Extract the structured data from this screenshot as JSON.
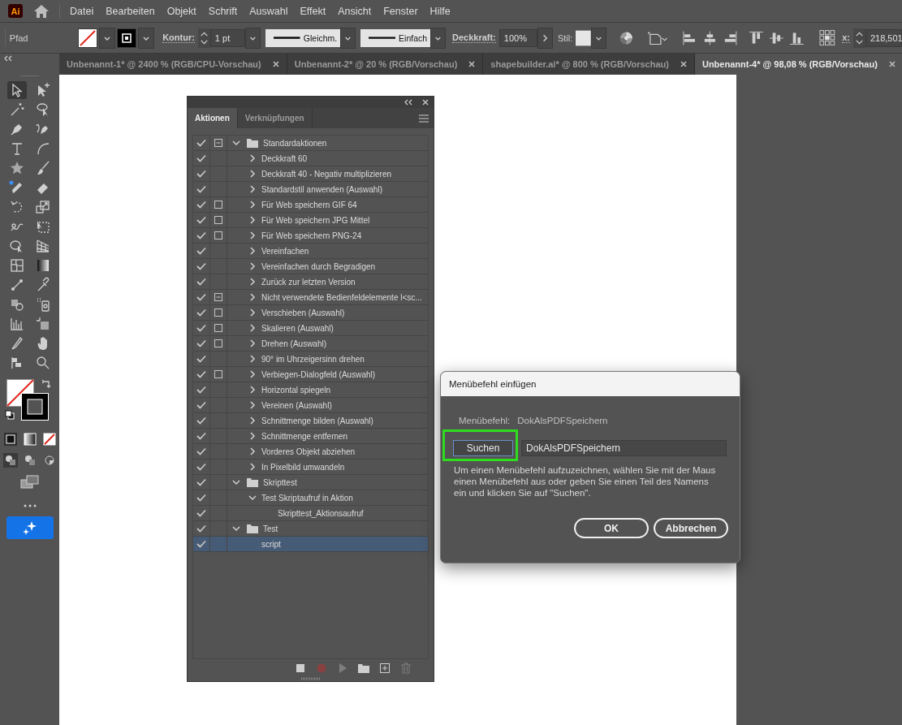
{
  "menu_bar": {
    "logo": "Ai",
    "items": [
      "Datei",
      "Bearbeiten",
      "Objekt",
      "Schrift",
      "Auswahl",
      "Effekt",
      "Ansicht",
      "Fenster",
      "Hilfe"
    ]
  },
  "control_bar": {
    "selection_label": "Pfad",
    "fill_none": true,
    "stroke_label": "Kontur:",
    "stroke_weight": "1 pt",
    "stroke_profile": "Gleichm.",
    "brush": "Einfach",
    "opacity_label": "Deckkraft:",
    "opacity": "100%",
    "style_label": "Stil:",
    "x_label": "x:",
    "x_value": "218,501"
  },
  "document_tabs": [
    {
      "label": "Unbenannt-1* @ 2400 % (RGB/CPU-Vorschau)",
      "selected": false
    },
    {
      "label": "Unbenannt-2* @ 20 % (RGB/Vorschau)",
      "selected": false
    },
    {
      "label": "shapebuilder.ai* @ 800 % (RGB/Vorschau)",
      "selected": false
    },
    {
      "label": "Unbenannt-4* @ 98,08 % (RGB/Vorschau)",
      "selected": true
    }
  ],
  "tools": [
    {
      "kind": "selection",
      "selected": true
    },
    {
      "kind": "direct_add",
      "selected": false
    },
    {
      "kind": "magic_wand",
      "selected": false
    },
    {
      "kind": "lasso",
      "selected": false
    },
    {
      "kind": "pen",
      "selected": false
    },
    {
      "kind": "curvature",
      "selected": false
    },
    {
      "kind": "type",
      "selected": false
    },
    {
      "kind": "arc",
      "selected": false
    },
    {
      "kind": "star",
      "selected": false
    },
    {
      "kind": "brush",
      "selected": false
    },
    {
      "kind": "pencil",
      "selected": false
    },
    {
      "kind": "eraser",
      "selected": false
    },
    {
      "kind": "rotate",
      "selected": false
    },
    {
      "kind": "scale",
      "selected": false
    },
    {
      "kind": "warp",
      "selected": false
    },
    {
      "kind": "free_transform",
      "selected": false
    },
    {
      "kind": "shape_builder",
      "selected": false
    },
    {
      "kind": "perspective",
      "selected": false
    },
    {
      "kind": "mesh",
      "selected": false
    },
    {
      "kind": "gradient",
      "selected": false
    },
    {
      "kind": "blend",
      "selected": false
    },
    {
      "kind": "eyedropper",
      "selected": false
    },
    {
      "kind": "symbol",
      "selected": false
    },
    {
      "kind": "spray",
      "selected": false
    },
    {
      "kind": "bar_chart",
      "selected": false
    },
    {
      "kind": "artboard",
      "selected": false
    },
    {
      "kind": "knife",
      "selected": false
    },
    {
      "kind": "hand",
      "selected": false
    },
    {
      "kind": "puppet",
      "selected": false
    },
    {
      "kind": "zoom",
      "selected": false
    }
  ],
  "swatches": {
    "fill_none": true
  },
  "actions_panel": {
    "tabs": [
      {
        "label": "Aktionen",
        "selected": true
      },
      {
        "label": "Verknüpfungen",
        "selected": false
      }
    ],
    "items": [
      {
        "label": "Standardaktionen",
        "folder": true,
        "enabled": true,
        "dialog_box": true,
        "dialog_mixed": true,
        "expandable": true,
        "expanded": true,
        "selected": false,
        "children": [
          {
            "label": "Deckkraft 60",
            "folder": false,
            "enabled": true,
            "dialog_box": false,
            "expandable": true,
            "expanded": false,
            "selected": false
          },
          {
            "label": "Deckkraft 40 - Negativ multiplizieren",
            "folder": false,
            "enabled": true,
            "dialog_box": false,
            "expandable": true,
            "expanded": false,
            "selected": false
          },
          {
            "label": "Standardstil anwenden (Auswahl)",
            "folder": false,
            "enabled": true,
            "dialog_box": false,
            "expandable": true,
            "expanded": false,
            "selected": false
          },
          {
            "label": "Für Web speichern GIF 64",
            "folder": false,
            "enabled": true,
            "dialog_box": true,
            "dialog_mixed": false,
            "expandable": true,
            "expanded": false,
            "selected": false
          },
          {
            "label": "Für Web speichern JPG Mittel",
            "folder": false,
            "enabled": true,
            "dialog_box": true,
            "dialog_mixed": false,
            "expandable": true,
            "expanded": false,
            "selected": false
          },
          {
            "label": "Für Web speichern PNG-24",
            "folder": false,
            "enabled": true,
            "dialog_box": true,
            "dialog_mixed": false,
            "expandable": true,
            "expanded": false,
            "selected": false
          },
          {
            "label": "Vereinfachen",
            "folder": false,
            "enabled": true,
            "dialog_box": false,
            "expandable": true,
            "expanded": false,
            "selected": false
          },
          {
            "label": "Vereinfachen durch Begradigen",
            "folder": false,
            "enabled": true,
            "dialog_box": false,
            "expandable": true,
            "expanded": false,
            "selected": false
          },
          {
            "label": "Zurück zur letzten Version",
            "folder": false,
            "enabled": true,
            "dialog_box": false,
            "expandable": true,
            "expanded": false,
            "selected": false
          },
          {
            "label": "Nicht verwendete Bedienfeldelemente l<sc...",
            "folder": false,
            "enabled": true,
            "dialog_box": true,
            "dialog_mixed": true,
            "expandable": true,
            "expanded": false,
            "selected": false
          },
          {
            "label": "Verschieben (Auswahl)",
            "folder": false,
            "enabled": true,
            "dialog_box": true,
            "dialog_mixed": false,
            "expandable": true,
            "expanded": false,
            "selected": false
          },
          {
            "label": "Skalieren (Auswahl)",
            "folder": false,
            "enabled": true,
            "dialog_box": true,
            "dialog_mixed": false,
            "expandable": true,
            "expanded": false,
            "selected": false
          },
          {
            "label": "Drehen (Auswahl)",
            "folder": false,
            "enabled": true,
            "dialog_box": true,
            "dialog_mixed": false,
            "expandable": true,
            "expanded": false,
            "selected": false
          },
          {
            "label": "90° im Uhrzeigersinn drehen",
            "folder": false,
            "enabled": true,
            "dialog_box": false,
            "expandable": true,
            "expanded": false,
            "selected": false
          },
          {
            "label": "Verbiegen-Dialogfeld (Auswahl)",
            "folder": false,
            "enabled": true,
            "dialog_box": true,
            "dialog_mixed": false,
            "expandable": true,
            "expanded": false,
            "selected": false
          },
          {
            "label": "Horizontal spiegeln",
            "folder": false,
            "enabled": true,
            "dialog_box": false,
            "expandable": true,
            "expanded": false,
            "selected": false
          },
          {
            "label": "Vereinen (Auswahl)",
            "folder": false,
            "enabled": true,
            "dialog_box": false,
            "expandable": true,
            "expanded": false,
            "selected": false
          },
          {
            "label": "Schnittmenge bilden (Auswahl)",
            "folder": false,
            "enabled": true,
            "dialog_box": false,
            "expandable": true,
            "expanded": false,
            "selected": false
          },
          {
            "label": "Schnittmenge entfernen",
            "folder": false,
            "enabled": true,
            "dialog_box": false,
            "expandable": true,
            "expanded": false,
            "selected": false
          },
          {
            "label": "Vorderes Objekt abziehen",
            "folder": false,
            "enabled": true,
            "dialog_box": false,
            "expandable": true,
            "expanded": false,
            "selected": false
          },
          {
            "label": "In Pixelbild umwandeln",
            "folder": false,
            "enabled": true,
            "dialog_box": false,
            "expandable": true,
            "expanded": false,
            "selected": false
          }
        ]
      },
      {
        "label": "Skripttest",
        "folder": true,
        "enabled": true,
        "dialog_box": false,
        "expandable": true,
        "expanded": true,
        "selected": false,
        "children": [
          {
            "label": "Test Skriptaufruf in Aktion",
            "folder": false,
            "enabled": true,
            "dialog_box": false,
            "expandable": true,
            "expanded": true,
            "selected": false,
            "children": [
              {
                "label": "Skripttest_Aktionsaufruf",
                "folder": false,
                "enabled": true,
                "dialog_box": false,
                "expandable": false,
                "selected": false
              }
            ]
          }
        ]
      },
      {
        "label": "Test",
        "folder": true,
        "enabled": true,
        "dialog_box": false,
        "expandable": true,
        "expanded": true,
        "selected": false,
        "children": [
          {
            "label": "script",
            "folder": false,
            "enabled": true,
            "dialog_box": false,
            "expandable": false,
            "selected": true
          }
        ]
      }
    ],
    "footer_buttons": [
      {
        "kind": "stop",
        "disabled": false
      },
      {
        "kind": "record",
        "disabled": true
      },
      {
        "kind": "play",
        "disabled": true
      },
      {
        "kind": "new_set",
        "disabled": false
      },
      {
        "kind": "new_action",
        "disabled": false
      },
      {
        "kind": "delete",
        "disabled": true
      }
    ]
  },
  "dialog": {
    "title": "Menübefehl einfügen",
    "command_label": "Menübefehl:",
    "command_value": "DokAlsPDFSpeichern",
    "search_button": {
      "label": "Suchen",
      "highlighted": true
    },
    "search_field": {
      "value": "DokAlsPDFSpeichern"
    },
    "help_text": "Um einen Menübefehl aufzuzeichnen, wählen Sie mit der Maus einen Menübefehl aus oder geben Sie einen Teil des Namens ein und klicken Sie auf \"Suchen\".",
    "buttons": [
      "OK",
      "Abbrechen"
    ]
  }
}
